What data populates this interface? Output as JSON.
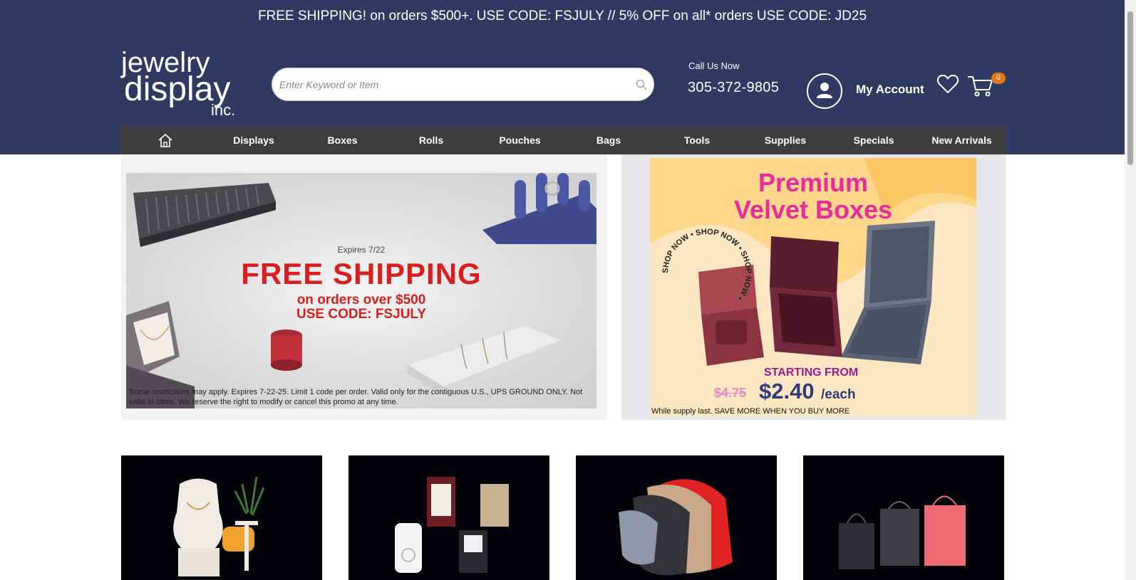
{
  "promo_bar": {
    "text": "FREE SHIPPING! on orders $500+. USE CODE: FSJULY // 5% OFF on all* orders USE CODE: JD25"
  },
  "logo": {
    "line1": "jewelry",
    "line2": "display",
    "line3": "inc."
  },
  "search": {
    "placeholder": "Enter Keyword or Item",
    "value": ""
  },
  "contact": {
    "label": "Call Us Now",
    "phone": "305-372-9805"
  },
  "account": {
    "label": "My Account"
  },
  "cart": {
    "count": "0"
  },
  "nav": {
    "items": [
      {
        "label": "Displays"
      },
      {
        "label": "Boxes"
      },
      {
        "label": "Rolls"
      },
      {
        "label": "Pouches"
      },
      {
        "label": "Bags"
      },
      {
        "label": "Tools"
      },
      {
        "label": "Supplies"
      },
      {
        "label": "Specials"
      },
      {
        "label": "New Arrivals"
      }
    ]
  },
  "banner_left": {
    "expires": "Expires 7/22",
    "title": "FREE SHIPPING",
    "sub1": "on orders over $500",
    "sub2": "USE CODE: FSJULY",
    "disclaimer": "Some restrictions may apply. Expires 7-22-25. Limit 1 code per order. Valid only for the contiguous U.S., UPS GROUND ONLY. Not valid In-store. We reserve the right to modify or cancel this promo at any time."
  },
  "banner_right": {
    "title1": "Premium",
    "title2": "Velvet Boxes",
    "shop_now": "SHOP NOW • SHOP NOW • SHOP NOW •",
    "starting": "STARTING FROM",
    "old_price": "$4.75",
    "new_price": "$2.40",
    "unit": "/each",
    "note": "While supply last. SAVE MORE WHEN YOU BUY MORE"
  },
  "colors": {
    "header_bg": "#2e3a62",
    "nav_bg": "#3d3d3d",
    "promo_red": "#d91e1e",
    "velvet_pink": "#ea2a9e",
    "price_navy": "#2e3d7a",
    "badge_orange": "#e2761b"
  }
}
